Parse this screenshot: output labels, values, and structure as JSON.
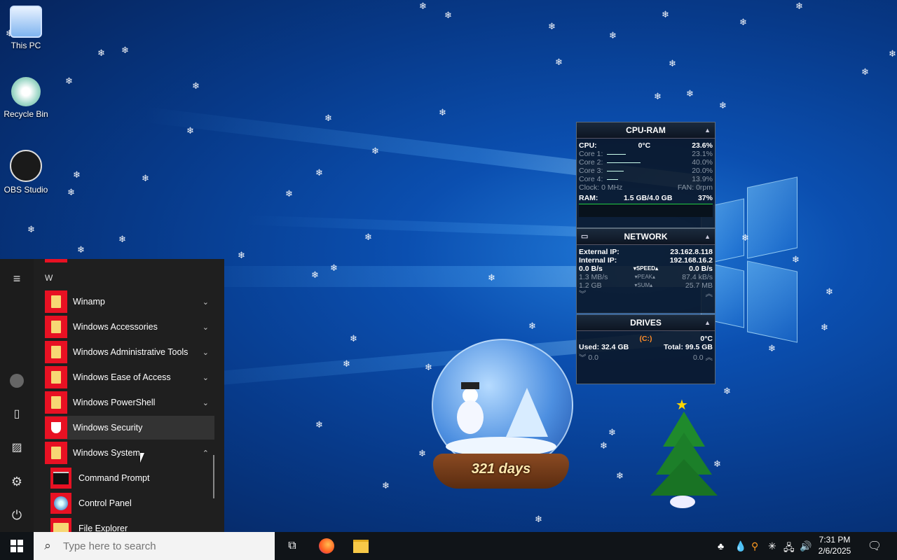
{
  "desktop": {
    "icons": [
      {
        "label": "This PC",
        "icon": "computer-icon"
      },
      {
        "label": "Recycle Bin",
        "icon": "recycle-bin-icon"
      },
      {
        "label": "OBS Studio",
        "icon": "obs-icon"
      }
    ],
    "snow_globe": {
      "label": "321 days"
    }
  },
  "widgets": {
    "cpu": {
      "title": "CPU-RAM",
      "cpu_label": "CPU:",
      "temp": "0°C",
      "cpu_pct": "23.6%",
      "cores": [
        {
          "label": "Core 1:",
          "value": "23.1%"
        },
        {
          "label": "Core 2:",
          "value": "40.0%"
        },
        {
          "label": "Core 3:",
          "value": "20.0%"
        },
        {
          "label": "Core 4:",
          "value": "13.9%"
        }
      ],
      "clock": "Clock: 0 MHz",
      "fan": "FAN: 0rpm",
      "ram_label": "RAM:",
      "ram_value": "1.5 GB/4.0 GB",
      "ram_pct": "37%"
    },
    "network": {
      "title": "NETWORK",
      "ext_label": "External IP:",
      "ext_ip": "23.162.8.118",
      "int_label": "Internal IP:",
      "int_ip": "192.168.16.2",
      "speed_down": "0.0 B/s",
      "speed_tag": "SPEED",
      "speed_up": "0.0 B/s",
      "peak_down": "1.3 MB/s",
      "peak_tag": "PEAK",
      "peak_up": "87.4 kB/s",
      "sum_down": "1.2 GB",
      "sum_tag": "SUM",
      "sum_up": "25.7 MB"
    },
    "drives": {
      "title": "DRIVES",
      "drive": "(C:)",
      "temp": "0°C",
      "used": "Used: 32.4 GB",
      "total": "Total: 99.5 GB",
      "read": "0.0",
      "write": "0.0"
    }
  },
  "start_menu": {
    "letter": "W",
    "apps": [
      {
        "label": "Winamp",
        "expand": "⌄"
      },
      {
        "label": "Windows Accessories",
        "expand": "⌄"
      },
      {
        "label": "Windows Administrative Tools",
        "expand": "⌄"
      },
      {
        "label": "Windows Ease of Access",
        "expand": "⌄"
      },
      {
        "label": "Windows PowerShell",
        "expand": "⌄"
      },
      {
        "label": "Windows Security",
        "expand": ""
      },
      {
        "label": "Windows System",
        "expand": "⌃"
      }
    ],
    "subitems": [
      {
        "label": "Command Prompt"
      },
      {
        "label": "Control Panel"
      },
      {
        "label": "File Explorer"
      }
    ]
  },
  "taskbar": {
    "search_placeholder": "Type here to search",
    "time": "7:31 PM",
    "date": "2/6/2025"
  }
}
